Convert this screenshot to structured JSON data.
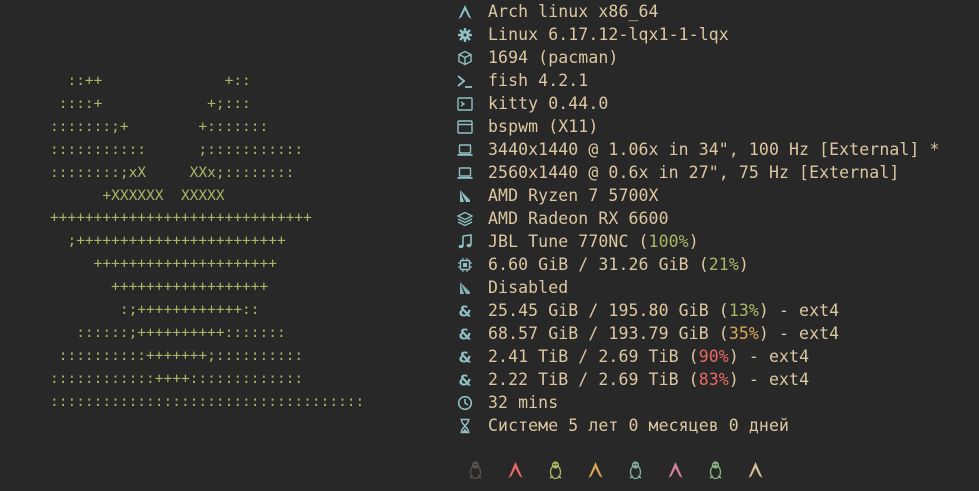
{
  "ascii_art": [
    "  ::++              +::",
    " ::::+            +;:::",
    ":::::::;+        +:::::::",
    ":::::::::::      ;:::::::::::",
    "::::::::;xX     XXx;::::::::",
    "      +XXXXXX  XXXXX",
    "++++++++++++++++++++++++++++++",
    "  ;++++++++++++++++++++++++",
    "     +++++++++++++++++++++",
    "       ++++++++++++++++++",
    "        :;++++++++++++::",
    "   ::::::;++++++++++:::::::",
    " ::::::::::+++++++;::::::::::",
    "::::::::::::++++:::::::::::::",
    "::::::::::::::::::::::::::::::::::::"
  ],
  "info": [
    {
      "icon": "arch-icon",
      "text": "Arch linux x86_64"
    },
    {
      "icon": "gear-icon",
      "text": "Linux 6.17.12-lqx1-1-lqx"
    },
    {
      "icon": "package-icon",
      "text": "1694 (pacman)"
    },
    {
      "icon": "shell-prompt-icon",
      "text": "fish 4.2.1"
    },
    {
      "icon": "terminal-icon",
      "text": "kitty 0.44.0"
    },
    {
      "icon": "window-icon",
      "text": "bspwm (X11)"
    },
    {
      "icon": "laptop-icon",
      "text": "3440x1440 @ 1.06x in 34\", 100 Hz [External] *"
    },
    {
      "icon": "laptop-icon",
      "text": "2560x1440 @ 0.6x in 27\", 75 Hz [External]"
    },
    {
      "icon": "cpu-chip-icon",
      "text": "AMD Ryzen 7 5700X"
    },
    {
      "icon": "layers-icon",
      "text": "AMD Radeon RX 6600"
    },
    {
      "icon": "music-note-icon",
      "text": "JBL Tune 770NC (",
      "pct": "100%",
      "pct_color": "#a9b665",
      "suffix": ")"
    },
    {
      "icon": "memory-icon",
      "text": "6.60 GiB / 31.26 GiB (",
      "pct": "21%",
      "pct_color": "#a9b665",
      "suffix": ")"
    },
    {
      "icon": "swap-icon",
      "text": "Disabled"
    },
    {
      "icon": "ampersand-disk-icon",
      "text": "25.45 GiB / 195.80 GiB (",
      "pct": "13%",
      "pct_color": "#a9b665",
      "suffix": ") - ext4"
    },
    {
      "icon": "ampersand-disk-icon",
      "text": "68.57 GiB / 193.79 GiB (",
      "pct": "35%",
      "pct_color": "#d8a657",
      "suffix": ") - ext4"
    },
    {
      "icon": "ampersand-disk-icon",
      "text": "2.41 TiB / 2.69 TiB (",
      "pct": "90%",
      "pct_color": "#ea6962",
      "suffix": ") - ext4"
    },
    {
      "icon": "ampersand-disk-icon",
      "text": "2.22 TiB / 2.69 TiB (",
      "pct": "83%",
      "pct_color": "#ea6962",
      "suffix": ") - ext4"
    },
    {
      "icon": "clock-icon",
      "text": "32 mins"
    },
    {
      "icon": "hourglass-icon",
      "text": "Системе 5 лет 0 месяцев 0 дней"
    }
  ],
  "palette": [
    {
      "icon": "tux-icon",
      "color": "#5a524c"
    },
    {
      "icon": "arch-icon",
      "color": "#ea6962"
    },
    {
      "icon": "tux-icon",
      "color": "#a9b665"
    },
    {
      "icon": "arch-icon",
      "color": "#d8a657"
    },
    {
      "icon": "tux-icon",
      "color": "#7daea3"
    },
    {
      "icon": "arch-icon",
      "color": "#d3869b"
    },
    {
      "icon": "tux-icon",
      "color": "#89b482"
    },
    {
      "icon": "arch-icon",
      "color": "#d4be98"
    }
  ],
  "colors": {
    "background": "#282828",
    "text": "#ddc7a1",
    "icon": "#8ec0c4",
    "ascii": "#a9b665"
  }
}
